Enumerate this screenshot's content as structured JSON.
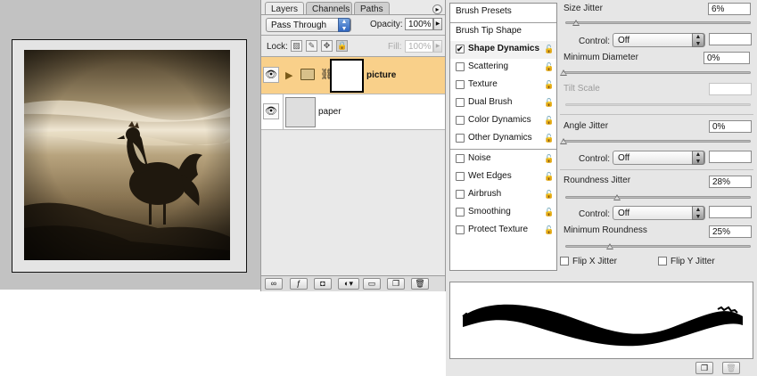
{
  "layers_panel": {
    "tabs": [
      "Layers",
      "Channels",
      "Paths"
    ],
    "active_tab": "Layers",
    "blend_mode": "Pass Through",
    "opacity_label": "Opacity:",
    "opacity_value": "100%",
    "lock_label": "Lock:",
    "fill_label": "Fill:",
    "fill_value": "100%",
    "layers": [
      {
        "name": "picture",
        "type": "group",
        "selected": true,
        "visible": true
      },
      {
        "name": "paper",
        "type": "layer",
        "selected": false,
        "visible": true
      }
    ]
  },
  "brushes_panel": {
    "list": [
      {
        "label": "Brush Presets",
        "checkbox": false,
        "lock": false
      },
      {
        "label": "Brush Tip Shape",
        "checkbox": false,
        "lock": false
      },
      {
        "label": "Shape Dynamics",
        "checkbox": true,
        "checked": true,
        "lock": true,
        "selected": true
      },
      {
        "label": "Scattering",
        "checkbox": true,
        "checked": false,
        "lock": true
      },
      {
        "label": "Texture",
        "checkbox": true,
        "checked": false,
        "lock": true
      },
      {
        "label": "Dual Brush",
        "checkbox": true,
        "checked": false,
        "lock": true
      },
      {
        "label": "Color Dynamics",
        "checkbox": true,
        "checked": false,
        "lock": true
      },
      {
        "label": "Other Dynamics",
        "checkbox": true,
        "checked": false,
        "lock": true
      },
      {
        "label": "Noise",
        "checkbox": true,
        "checked": false,
        "lock": true
      },
      {
        "label": "Wet Edges",
        "checkbox": true,
        "checked": false,
        "lock": true
      },
      {
        "label": "Airbrush",
        "checkbox": true,
        "checked": false,
        "lock": true
      },
      {
        "label": "Smoothing",
        "checkbox": true,
        "checked": false,
        "lock": true
      },
      {
        "label": "Protect Texture",
        "checkbox": true,
        "checked": false,
        "lock": true
      }
    ],
    "options": {
      "size_jitter": {
        "label": "Size Jitter",
        "value": "6%",
        "fraction": 0.06
      },
      "size_control": {
        "label": "Control:",
        "value": "Off"
      },
      "minimum_diameter": {
        "label": "Minimum Diameter",
        "value": "0%",
        "fraction": 0.0
      },
      "tilt_scale": {
        "label": "Tilt Scale",
        "value": ""
      },
      "angle_jitter": {
        "label": "Angle Jitter",
        "value": "0%",
        "fraction": 0.0
      },
      "angle_control": {
        "label": "Control:",
        "value": "Off"
      },
      "roundness_jitter": {
        "label": "Roundness Jitter",
        "value": "28%",
        "fraction": 0.28
      },
      "roundness_control": {
        "label": "Control:",
        "value": "Off"
      },
      "minimum_roundness": {
        "label": "Minimum Roundness",
        "value": "25%",
        "fraction": 0.25
      },
      "flip_x": {
        "label": "Flip X Jitter",
        "checked": false
      },
      "flip_y": {
        "label": "Flip Y Jitter",
        "checked": false
      }
    }
  },
  "colors": {
    "selected_layer": "#f9d08a",
    "canvas_bg": "#c2c2c2",
    "accent_blue": "#2f66c0"
  }
}
